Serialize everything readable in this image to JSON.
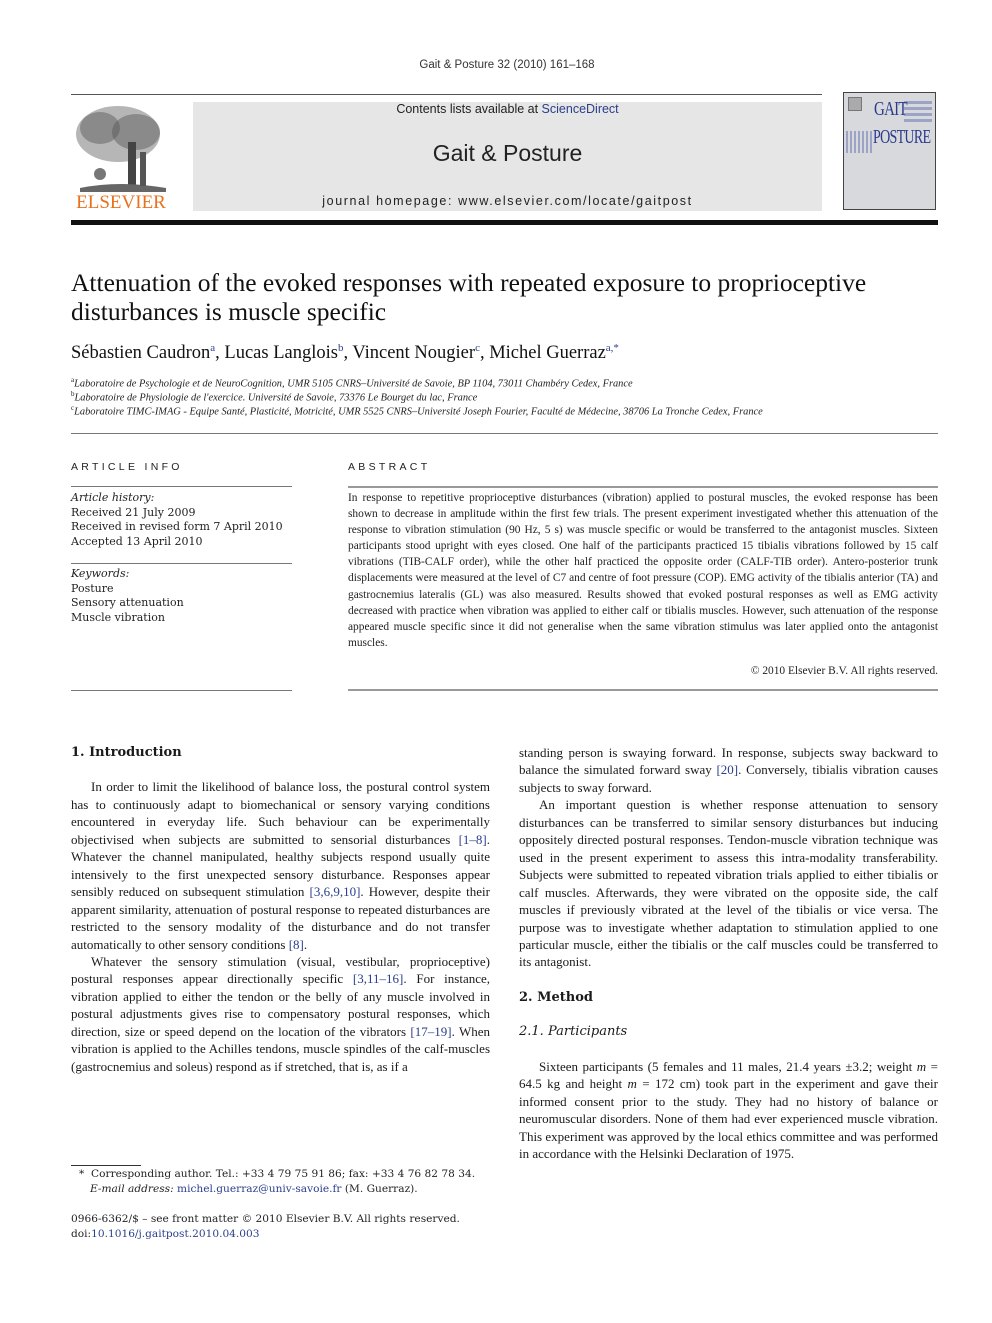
{
  "running_head": "Gait & Posture 32 (2010) 161–168",
  "header": {
    "publisher_logo_text": "ELSEVIER",
    "contents_prefix": "Contents lists available at ",
    "contents_link": "ScienceDirect",
    "journal_name": "Gait & Posture",
    "homepage": "journal homepage: www.elsevier.com/locate/gaitpost",
    "cover_title_top": "GAIT",
    "cover_title_bottom": "POSTURE"
  },
  "article": {
    "title": "Attenuation of the evoked responses with repeated exposure to proprioceptive disturbances is muscle specific",
    "authors": [
      {
        "name": "Sébastien Caudron",
        "sup": "a"
      },
      {
        "name": "Lucas Langlois",
        "sup": "b"
      },
      {
        "name": "Vincent Nougier",
        "sup": "c"
      },
      {
        "name": "Michel Guerraz",
        "sup": "a,*"
      }
    ],
    "affiliations": [
      {
        "sup": "a",
        "text": "Laboratoire de Psychologie et de NeuroCognition, UMR 5105 CNRS–Université de Savoie, BP 1104, 73011 Chambéry Cedex, France"
      },
      {
        "sup": "b",
        "text": "Laboratoire de Physiologie de l'exercice. Université de Savoie, 73376 Le Bourget du lac, France"
      },
      {
        "sup": "c",
        "text": "Laboratoire TIMC-IMAG - Equipe Santé, Plasticité, Motricité, UMR 5525 CNRS–Université Joseph Fourier, Faculté de Médecine, 38706 La Tronche Cedex, France"
      }
    ]
  },
  "article_info": {
    "heading": "ARTICLE INFO",
    "history_label": "Article history:",
    "history": [
      "Received 21 July 2009",
      "Received in revised form 7 April 2010",
      "Accepted 13 April 2010"
    ],
    "keywords_label": "Keywords:",
    "keywords": [
      "Posture",
      "Sensory attenuation",
      "Muscle vibration"
    ]
  },
  "abstract": {
    "heading": "ABSTRACT",
    "text": "In response to repetitive proprioceptive disturbances (vibration) applied to postural muscles, the evoked response has been shown to decrease in amplitude within the first few trials. The present experiment investigated whether this attenuation of the response to vibration stimulation (90 Hz, 5 s) was muscle specific or would be transferred to the antagonist muscles. Sixteen participants stood upright with eyes closed. One half of the participants practiced 15 tibialis vibrations followed by 15 calf vibrations (TIB-CALF order), while the other half practiced the opposite order (CALF-TIB order). Antero-posterior trunk displacements were measured at the level of C7 and centre of foot pressure (COP). EMG activity of the tibialis anterior (TA) and gastrocnemius lateralis (GL) was also measured. Results showed that evoked postural responses as well as EMG activity decreased with practice when vibration was applied to either calf or tibialis muscles. However, such attenuation of the response appeared muscle specific since it did not generalise when the same vibration stimulus was later applied onto the antagonist muscles.",
    "copyright": "© 2010 Elsevier B.V. All rights reserved."
  },
  "body_left": {
    "intro_heading": "1.  Introduction",
    "p1": [
      {
        "t": "In order to limit the likelihood of balance loss, the postural control system has to continuously adapt to biomechanical or sensory varying conditions encountered in everyday life. Such behaviour can be experimentally objectivised when subjects are submitted to sensorial disturbances "
      },
      {
        "ref": "[1–8]"
      },
      {
        "t": ". Whatever the channel manipulated, healthy subjects respond usually quite intensively to the first unexpected sensory disturbance. Responses appear sensibly reduced on subsequent stimulation "
      },
      {
        "ref": "[3,6,9,10]"
      },
      {
        "t": ". However, despite their apparent similarity, attenuation of postural response to repeated disturbances are restricted to the sensory modality of the disturbance and do not transfer automatically to other sensory conditions "
      },
      {
        "ref": "[8]"
      },
      {
        "t": "."
      }
    ],
    "p2": [
      {
        "t": "Whatever the sensory stimulation (visual, vestibular, proprioceptive) postural responses appear directionally specific "
      },
      {
        "ref": "[3,11–16]"
      },
      {
        "t": ". For instance, vibration applied to either the tendon or the belly of any muscle involved in postural adjustments gives rise to compensatory postural responses, which direction, size or speed depend on the location of the vibrators "
      },
      {
        "ref": "[17–19]"
      },
      {
        "t": ". When vibration is applied to the Achilles tendons, muscle spindles of the calf-muscles (gastrocnemius and soleus) respond as if stretched, that is, as if a"
      }
    ]
  },
  "body_right": {
    "p1": [
      {
        "t": "standing person is swaying forward. In response, subjects sway backward to balance the simulated forward sway "
      },
      {
        "ref": "[20]"
      },
      {
        "t": ". Conversely, tibialis vibration causes subjects to sway forward."
      }
    ],
    "p2": [
      {
        "t": "An important question is whether response attenuation to sensory disturbances can be transferred to similar sensory disturbances but inducing oppositely directed postural responses. Tendon-muscle vibration technique was used in the present experiment to assess this intra-modality transferability. Subjects were submitted to repeated vibration trials applied to either tibialis or calf muscles. Afterwards, they were vibrated on the opposite side, the calf muscles if previously vibrated at the level of the tibialis or vice versa. The purpose was to investigate whether adaptation to stimulation applied to one particular muscle, either the tibialis or the calf muscles could be transferred to its antagonist."
      }
    ],
    "method_heading": "2.  Method",
    "participants_heading": "2.1.  Participants",
    "p3": [
      {
        "t": "Sixteen participants (5 females and 11 males, 21.4 years ±3.2; weight "
      },
      {
        "it": "m"
      },
      {
        "t": " = 64.5 kg and height "
      },
      {
        "it": "m"
      },
      {
        "t": " = 172 cm) took part in the experiment and gave their informed consent prior to the study. They had no history of balance or neuromuscular disorders. None of them had ever experienced muscle vibration. This experiment was approved by the local ethics committee and was performed in accordance with the Helsinki Declaration of 1975."
      }
    ]
  },
  "footnotes": {
    "corresponding": "Corresponding author. Tel.: +33 4 79 75 91 86; fax: +33 4 76 82 78 34.",
    "email_label": "E-mail address:",
    "email": "michel.guerraz@univ-savoie.fr",
    "email_suffix": " (M. Guerraz).",
    "issn": "0966-6362/$ – see front matter © 2010 Elsevier B.V. All rights reserved.",
    "doi_prefix": "doi:",
    "doi": "10.1016/j.gaitpost.2010.04.003"
  },
  "colors": {
    "link": "#2a3e8c",
    "elsevier_orange": "#e9711c",
    "banner_gray": "#e6e6e6"
  }
}
